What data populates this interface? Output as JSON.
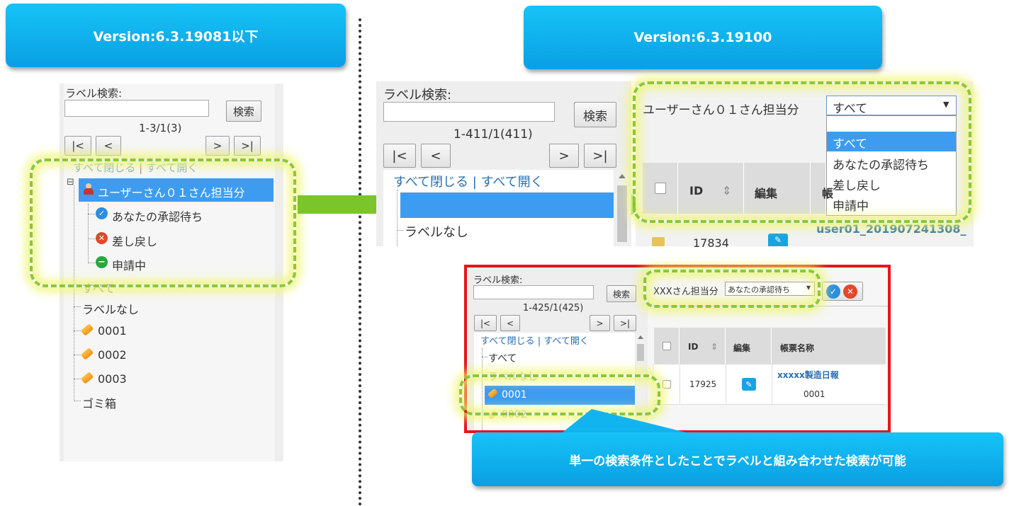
{
  "left_banner": "Version:6.3.19081以下",
  "right_banner": "Version:6.3.19100",
  "callout": "単一の検索条件としたことでラベルと組み合わせた検索が可能",
  "common": {
    "label_search": "ラベル検索:",
    "search_button": "検索",
    "first": "|<",
    "prev": "<",
    "next": ">",
    "last": ">|",
    "collapse_all": "すべて閉じる",
    "separator": "|",
    "expand_all": "すべて開く",
    "all": "すべて",
    "no_label": "ラベルなし"
  },
  "old_panel": {
    "count": "1-3/1(3)",
    "expander": "⊟",
    "user_node": "ユーザーさん０１さん担当分",
    "children": [
      "あなたの承認待ち",
      "差し戻し",
      "申請中"
    ],
    "labels": [
      "0001",
      "0002",
      "0003"
    ],
    "trash": "ゴミ箱"
  },
  "new_panel": {
    "count": "1-411/1(411)",
    "filter_label": "ユーザーさん０１さん担当分",
    "dropdown_value": "すべて",
    "dropdown_caret": "▼",
    "dropdown_options": [
      "すべて",
      "あなたの承認待ち",
      "差し戻し",
      "申請中"
    ],
    "columns": {
      "id": "ID",
      "sort": "⇕",
      "edit": "編集",
      "form": "帳"
    },
    "row": {
      "id": "17834",
      "link": "user01_201907241308_"
    }
  },
  "example_panel": {
    "count": "1-425/1(425)",
    "filter_label": "XXXさん担当分",
    "dropdown_value": "あなたの承認待ち",
    "dropdown_caret": "▼",
    "labels": [
      "0001",
      "0002"
    ],
    "columns": {
      "id": "ID",
      "sort": "⇕",
      "edit": "編集",
      "form": "帳票名称"
    },
    "row": {
      "id": "17925",
      "name": "xxxxx製造日報",
      "label": "0001"
    }
  },
  "colors": {
    "banner": "#0fb0ee",
    "selection": "#3d9cf0",
    "highlight_dash": "#8cc63f",
    "arrow": "#7ac52b",
    "example_border": "#e8141b"
  }
}
